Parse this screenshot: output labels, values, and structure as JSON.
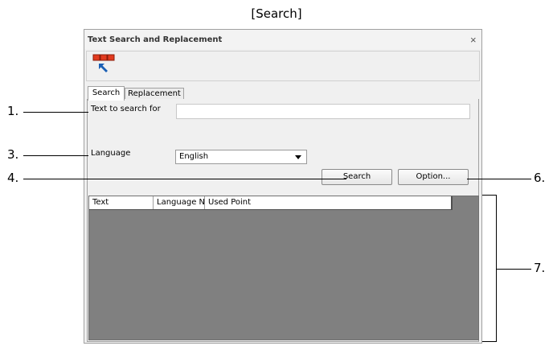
{
  "caption": "[Search]",
  "dialog": {
    "title": "Text Search and Replacement",
    "close_glyph": "×",
    "toolbar": {
      "icon": "select-arrow-icon"
    }
  },
  "tabs": [
    {
      "label": "Search",
      "active": true
    },
    {
      "label": "Replacement",
      "active": false
    }
  ],
  "form": {
    "search_label": "Text to search for",
    "search_value": "",
    "language_label": "Language",
    "language_value": "English",
    "search_button": "Search",
    "option_button": "Option..."
  },
  "results": {
    "columns": [
      "Text",
      "Language N",
      "Used Point"
    ],
    "rows": []
  },
  "callouts": {
    "c1": "1.",
    "c3": "3.",
    "c4": "4.",
    "c6": "6.",
    "c7": "7."
  },
  "colors": {
    "grid_bg": "#808080",
    "toolbar_icon_red": "#e23a1e",
    "toolbar_icon_arrow": "#1a5fb4"
  }
}
